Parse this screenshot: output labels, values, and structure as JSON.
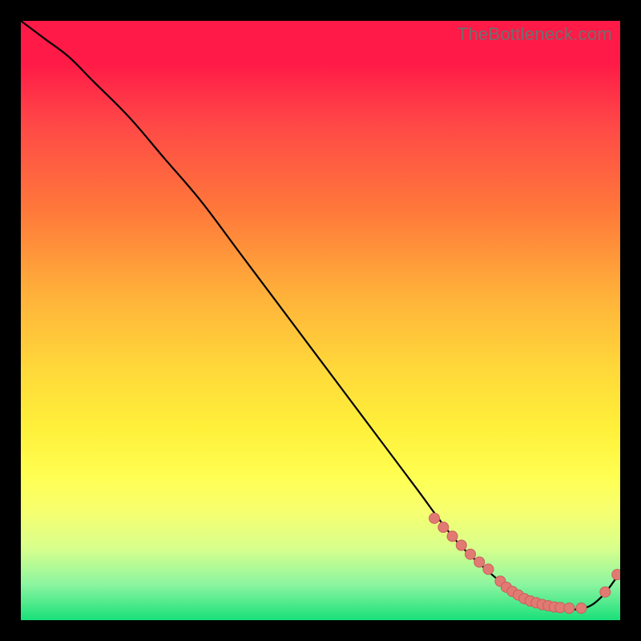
{
  "watermark": "TheBottleneck.com",
  "colors": {
    "curve": "#000000",
    "marker_fill": "#e27a74",
    "marker_stroke": "#c85f5a"
  },
  "chart_data": {
    "type": "line",
    "title": "",
    "xlabel": "",
    "ylabel": "",
    "xlim": [
      0,
      100
    ],
    "ylim": [
      0,
      100
    ],
    "curve": {
      "x": [
        0,
        4,
        8,
        12,
        18,
        24,
        30,
        36,
        42,
        48,
        54,
        60,
        66,
        72,
        77,
        82,
        86,
        90,
        94,
        97,
        100
      ],
      "y": [
        100,
        97,
        94,
        90,
        84,
        77,
        70,
        62,
        54,
        46,
        38,
        30,
        22,
        14,
        9,
        5,
        3,
        2,
        2,
        4,
        8
      ]
    },
    "markers": {
      "x": [
        69,
        70.5,
        72,
        73.5,
        75,
        76.5,
        78,
        80,
        81,
        82,
        83,
        84,
        85,
        86,
        87,
        88,
        89,
        90,
        91.5,
        93.5,
        97.5,
        99.5
      ],
      "y": [
        17,
        15.5,
        14,
        12.5,
        11,
        9.7,
        8.5,
        6.5,
        5.5,
        4.8,
        4.2,
        3.6,
        3.2,
        2.9,
        2.6,
        2.4,
        2.2,
        2.1,
        2.0,
        2.0,
        4.7,
        7.6
      ]
    }
  }
}
